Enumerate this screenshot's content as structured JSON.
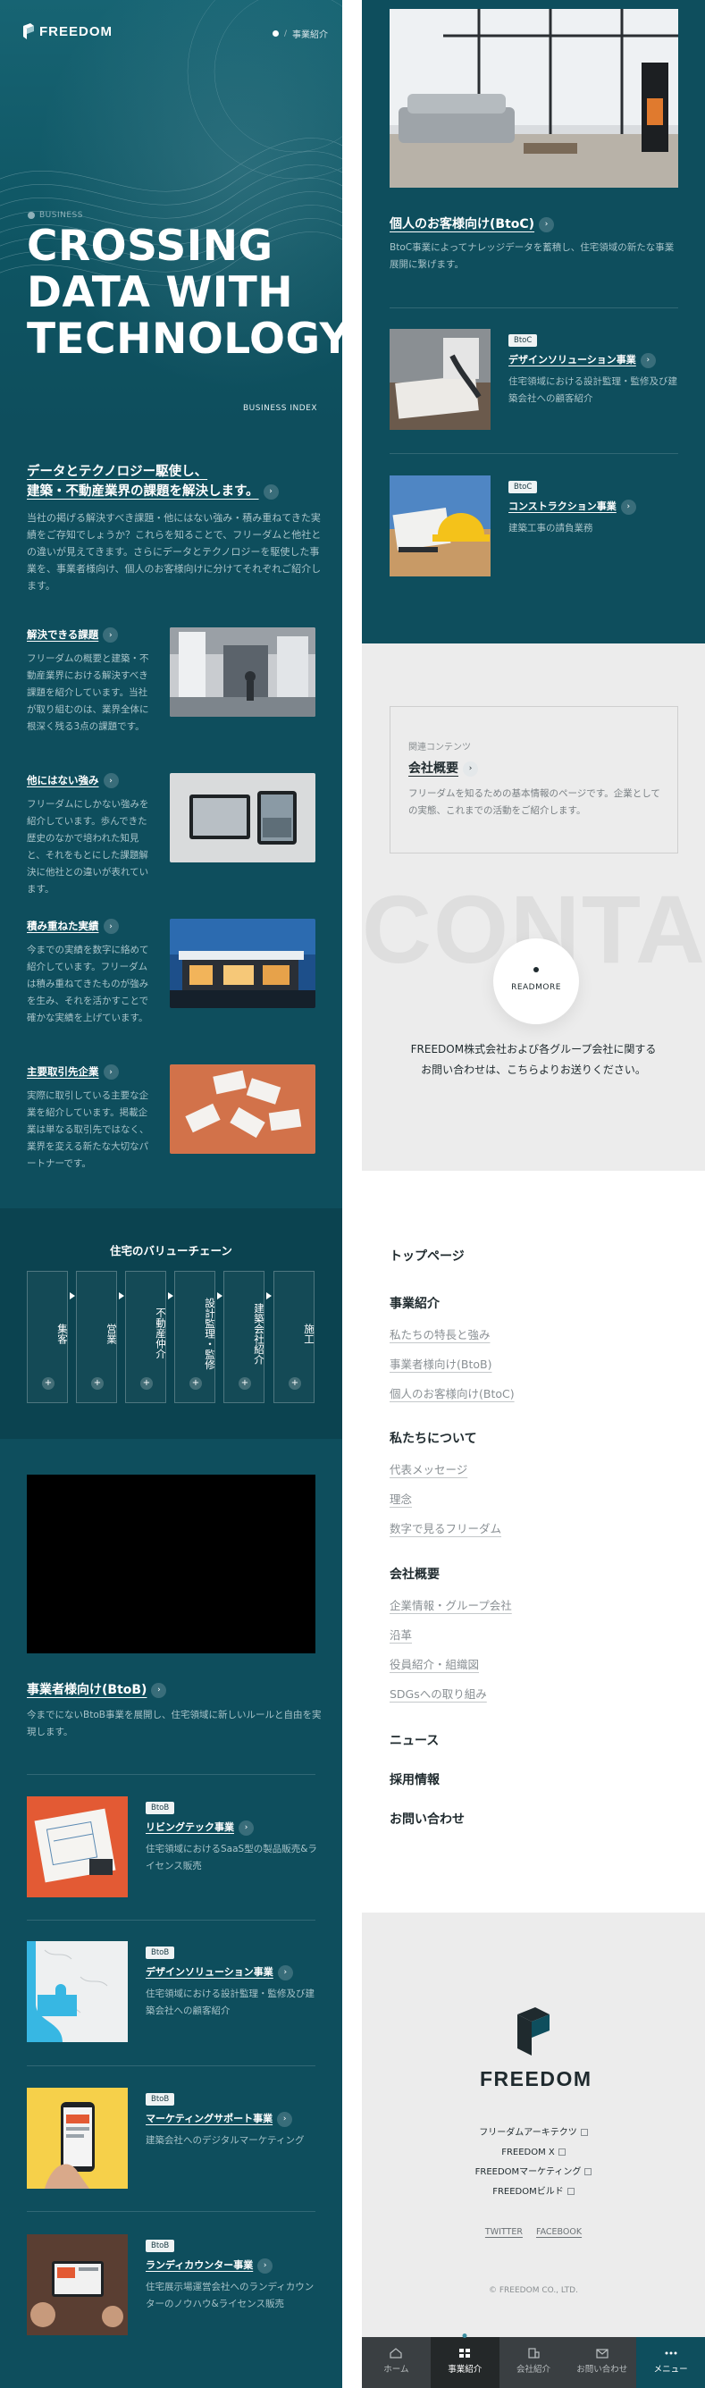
{
  "header": {
    "logo_text": "FREEDOM",
    "breadcrumb_current": "事業紹介"
  },
  "hero": {
    "eyebrow": "BUSINESS",
    "title_lines": [
      "CROSSING",
      "DATA WITH",
      "TECHNOLOGY"
    ],
    "index_label": "BUSINESS INDEX"
  },
  "intro": {
    "heading_line1": "データとテクノロジー駆使し、",
    "heading_line2": "建築・不動産業界の課題を解決します。",
    "body": "当社の掲げる解決すべき課題・他にはない強み・積み重ねてきた実績をご存知でしょうか？これらを知ることで、フリーダムと他社との違いが見えてきます。さらにデータとテクノロジーを駆使した事業を、事業者様向け、個人のお客様向けに分けてそれぞれご紹介します。"
  },
  "features": [
    {
      "title": "解決できる課題",
      "body": "フリーダムの概要と建築・不動産業界における解決すべき課題を紹介しています。当社が取り組むのは、業界全体に根深く残る3点の課題です。"
    },
    {
      "title": "他にはない強み",
      "body": "フリーダムにしかない強みを紹介しています。歩んできた歴史のなかで培われた知見と、それをもとにした課題解決に他社との違いが表れています。"
    },
    {
      "title": "積み重ねた実績",
      "body": "今までの実績を数字に絡めて紹介しています。フリーダムは積み重ねてきたものが強みを生み、それを活かすことで確かな実績を上げています。"
    },
    {
      "title": "主要取引先企業",
      "body": "実際に取引している主要な企業を紹介しています。掲載企業は単なる取引先ではなく、業界を変える新たな大切なパートナーです。"
    }
  ],
  "value_chain": {
    "title": "住宅のバリューチェーン",
    "items": [
      "集客",
      "営業",
      "不動産仲介",
      "設計監理・監修",
      "建築会社紹介",
      "施工"
    ]
  },
  "btob": {
    "title": "事業者様向け(BtoB)",
    "desc": "今までにないBtoB事業を展開し、住宅領域に新しいルールと自由を実現します。",
    "products": [
      {
        "badge": "BtoB",
        "title": "リビングテック事業",
        "desc": "住宅領域におけるSaaS型の製品販売&ライセンス販売"
      },
      {
        "badge": "BtoB",
        "title": "デザインソリューション事業",
        "desc": "住宅領域における設計監理・監修及び建築会社への顧客紹介"
      },
      {
        "badge": "BtoB",
        "title": "マーケティングサポート事業",
        "desc": "建築会社へのデジタルマーケティング"
      },
      {
        "badge": "BtoB",
        "title": "ランディカウンター事業",
        "desc": "住宅展示場運営会社へのランディカウンターのノウハウ&ライセンス販売"
      }
    ]
  },
  "btoc": {
    "title": "個人のお客様向け(BtoC)",
    "desc": "BtoC事業によってナレッジデータを蓄積し、住宅領域の新たな事業展開に繋げます。",
    "products": [
      {
        "badge": "BtoC",
        "title": "デザインソリューション事業",
        "desc": "住宅領域における設計監理・監修及び建築会社への顧客紹介"
      },
      {
        "badge": "BtoC",
        "title": "コンストラクション事業",
        "desc": "建築工事の請負業務"
      }
    ]
  },
  "related": {
    "eyebrow": "関連コンテンツ",
    "title": "会社概要",
    "desc": "フリーダムを知るための基本情報のページです。企業としての実態、これまでの活動をご紹介します。"
  },
  "contact": {
    "bg_text": "CONTACT",
    "readmore": "READMORE",
    "line1": "FREEDOM株式会社および各グループ会社に関する",
    "line2": "お問い合わせは、こちらよりお送りください。"
  },
  "sitemap": {
    "top": "トップページ",
    "business": "事業紹介",
    "business_links": [
      "私たちの特長と強み",
      "事業者様向け(BtoB)",
      "個人のお客様向け(BtoC)"
    ],
    "about": "私たちについて",
    "about_links": [
      "代表メッセージ",
      "理念",
      "数字で見るフリーダム"
    ],
    "company": "会社概要",
    "company_links": [
      "企業情報・グループ会社",
      "沿革",
      "役員紹介・組織図",
      "SDGsへの取り組み"
    ],
    "news": "ニュース",
    "recruit": "採用情報",
    "inquiry": "お問い合わせ"
  },
  "footer": {
    "logo_text": "FREEDOM",
    "links": [
      "フリーダムアーキテクツ",
      "FREEDOM X",
      "FREEDOMマーケティング",
      "FREEDOMビルド"
    ],
    "social": [
      "TWITTER",
      "FACEBOOK"
    ],
    "copyright": "© FREEDOM CO., LTD."
  },
  "tabbar": [
    {
      "label": "ホーム",
      "icon": "home-icon"
    },
    {
      "label": "事業紹介",
      "icon": "grid-icon"
    },
    {
      "label": "会社紹介",
      "icon": "building-icon"
    },
    {
      "label": "お問い合わせ",
      "icon": "mail-icon"
    },
    {
      "label": "メニュー",
      "icon": "dots-icon"
    }
  ],
  "colors": {
    "teal": "#0e4e5d",
    "teal_dark": "#0b4350",
    "gray": "#ececec",
    "text": "#1f2a2e"
  }
}
